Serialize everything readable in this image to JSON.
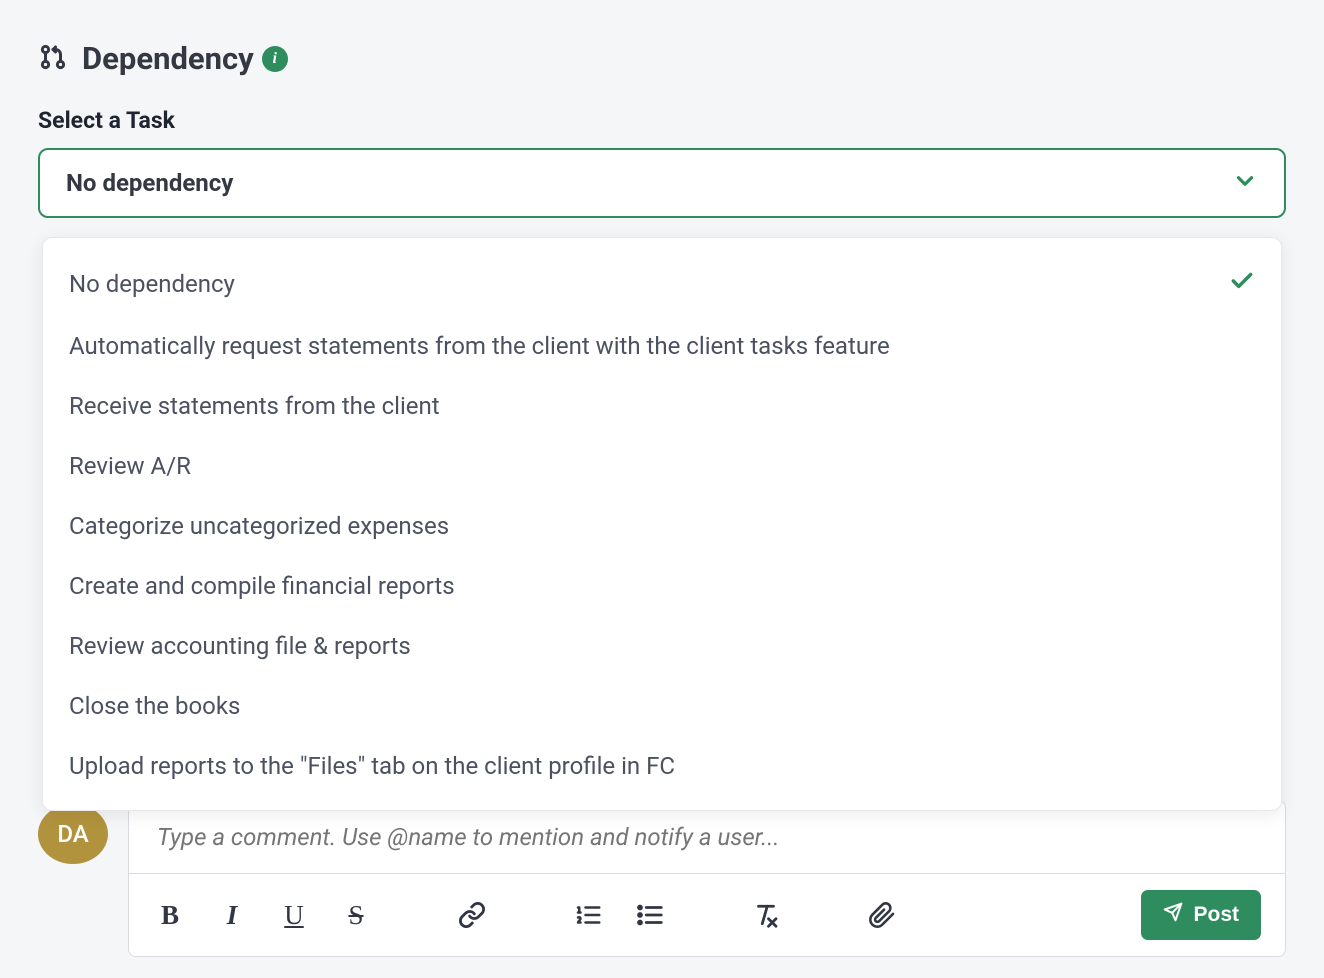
{
  "section": {
    "title": "Dependency"
  },
  "field": {
    "label": "Select a Task",
    "selected": "No dependency"
  },
  "options": [
    "No dependency",
    "Automatically request statements from the client with the client tasks feature",
    "Receive statements from the client",
    "Review A/R",
    "Categorize uncategorized expenses",
    "Create and compile financial reports",
    "Review accounting file & reports",
    "Close the books",
    "Upload reports to the \"Files\" tab on the client profile in FC"
  ],
  "selected_index": 0,
  "comment": {
    "avatar_initials": "DA",
    "placeholder": "Type a comment. Use @name to mention and notify a user..."
  },
  "toolbar": {
    "post_label": "Post"
  }
}
